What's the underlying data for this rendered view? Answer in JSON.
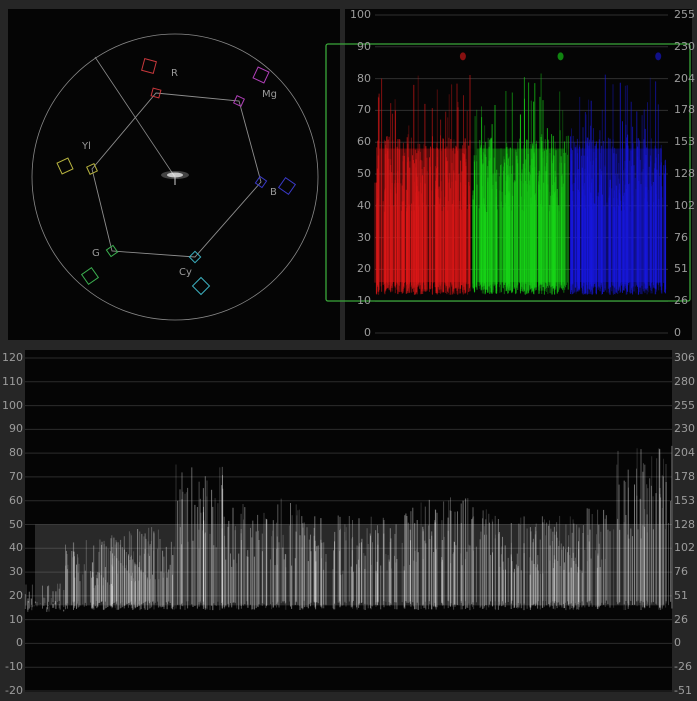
{
  "vectorscope": {
    "targets": [
      {
        "label": "R",
        "color": "#c8383c"
      },
      {
        "label": "Mg",
        "color": "#b040b8"
      },
      {
        "label": "B",
        "color": "#3a3ac8"
      },
      {
        "label": "Cy",
        "color": "#3cb0c0"
      },
      {
        "label": "G",
        "color": "#3cb050"
      },
      {
        "label": "Yl",
        "color": "#b8b440"
      }
    ]
  },
  "parade": {
    "left_ticks": [
      "100",
      "90",
      "80",
      "70",
      "60",
      "50",
      "40",
      "30",
      "20",
      "10",
      "0"
    ],
    "right_ticks": [
      "255",
      "230",
      "204",
      "178",
      "153",
      "128",
      "102",
      "76",
      "51",
      "26",
      "0"
    ],
    "channel_colors": [
      "#e01818",
      "#18d818",
      "#1818e0"
    ],
    "outline_color": "#3aa83a"
  },
  "waveform": {
    "left_ticks": [
      "120",
      "110",
      "100",
      "90",
      "80",
      "70",
      "60",
      "50",
      "40",
      "30",
      "20",
      "10",
      "0",
      "-10",
      "-20"
    ],
    "right_ticks": [
      "306",
      "280",
      "255",
      "230",
      "204",
      "178",
      "153",
      "128",
      "102",
      "76",
      "51",
      "26",
      "0",
      "-26",
      "-51"
    ]
  }
}
